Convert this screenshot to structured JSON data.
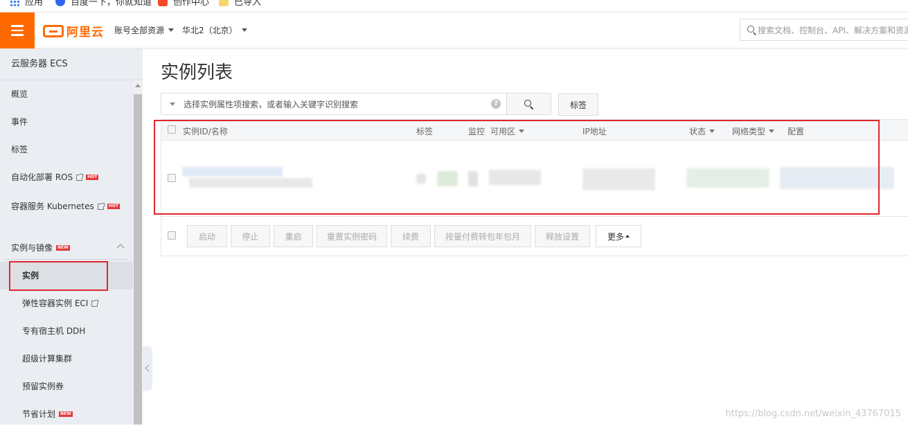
{
  "bookmarks": [
    {
      "label": "应用",
      "icon": "apps-grid-icon"
    },
    {
      "label": "百度一下，你就知道",
      "icon": "baidu-paw-icon"
    },
    {
      "label": "创作中心",
      "icon": "csdn-c-icon"
    },
    {
      "label": "已导入",
      "icon": "folder-icon"
    }
  ],
  "topbar": {
    "brand": "阿里云",
    "account_scope": "账号全部资源",
    "region": "华北2（北京）",
    "search_placeholder": "搜索文档、控制台、API、解决方案和资源"
  },
  "sidebar": {
    "title": "云服务器 ECS",
    "items": [
      {
        "label": "概览"
      },
      {
        "label": "事件"
      },
      {
        "label": "标签"
      },
      {
        "label": "自动化部署 ROS",
        "badge": "HOT"
      },
      {
        "label": "容器服务 Kubernetes",
        "badge": "HOT"
      },
      {
        "label": "实例与镜像",
        "badge": "NEW"
      },
      {
        "label": "实例"
      },
      {
        "label": "弹性容器实例 ECI"
      },
      {
        "label": "专有宿主机 DDH"
      },
      {
        "label": "超级计算集群"
      },
      {
        "label": "预留实例券"
      },
      {
        "label": "节省计划",
        "badge": "NEW"
      }
    ]
  },
  "main": {
    "title": "实例列表",
    "filter_placeholder": "选择实例属性项搜索，或者输入关键字识别搜索",
    "help": "?",
    "tag_button": "标签",
    "columns": [
      "实例ID/名称",
      "标签",
      "监控",
      "可用区",
      "IP地址",
      "状态",
      "网络类型",
      "配置"
    ],
    "actions": [
      "启动",
      "停止",
      "重启",
      "重置实例密码",
      "续费",
      "按量付费转包年包月",
      "释放设置",
      "更多"
    ]
  },
  "watermark": "https://blog.csdn.net/weixin_43767015",
  "colors": {
    "brand": "#ff6a00",
    "highlight": "#e0262d",
    "sidebar_bg": "#eaedf1"
  }
}
